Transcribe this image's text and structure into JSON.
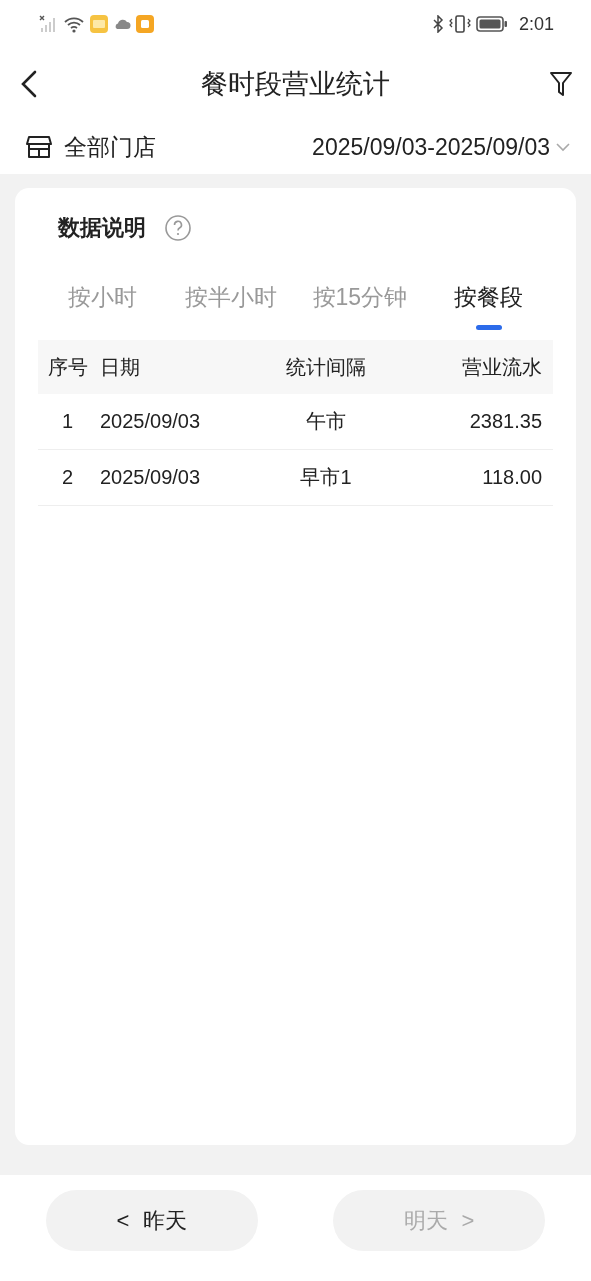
{
  "status_bar": {
    "time": "2:01"
  },
  "header": {
    "title": "餐时段营业统计"
  },
  "filter_row": {
    "store": "全部门店",
    "date_range": "2025/09/03-2025/09/03"
  },
  "card": {
    "title": "数据说明",
    "tabs": [
      {
        "label": "按小时",
        "selected": false
      },
      {
        "label": "按半小时",
        "selected": false
      },
      {
        "label": "按15分钟",
        "selected": false
      },
      {
        "label": "按餐段",
        "selected": true
      }
    ],
    "table": {
      "columns": [
        "序号",
        "日期",
        "统计间隔",
        "营业流水"
      ],
      "rows": [
        [
          "1",
          "2025/09/03",
          "午市",
          "2381.35"
        ],
        [
          "2",
          "2025/09/03",
          "早市1",
          "118.00"
        ]
      ]
    }
  },
  "nav_buttons": [
    {
      "kind": "prev",
      "arrow": "<",
      "label": "昨天",
      "disabled": false
    },
    {
      "kind": "next",
      "arrow": ">",
      "label": "明天",
      "disabled": true
    }
  ]
}
